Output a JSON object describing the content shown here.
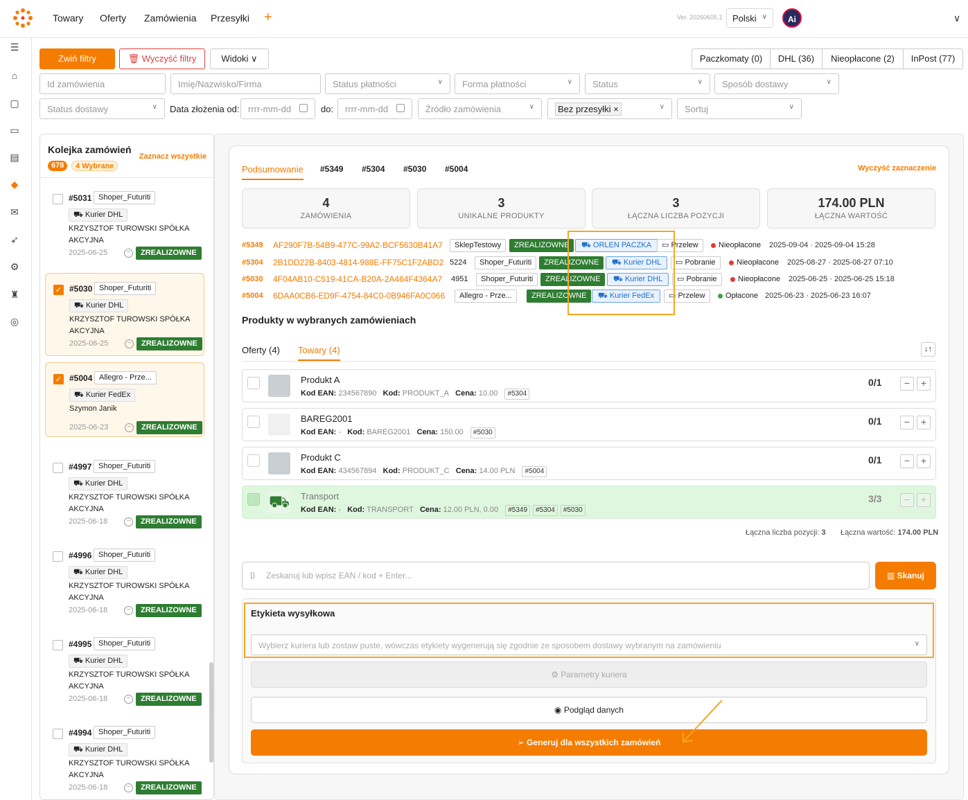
{
  "nav": {
    "items": [
      "Towary",
      "Oferty",
      "Zamówienia",
      "Przesyłki"
    ],
    "version": "Ver. 20260605.1",
    "language": "Polski",
    "avatar_text": "Ai"
  },
  "filters": {
    "collapse": "Zwiń filtry",
    "clear": "Wyczyść filtry",
    "views": "Widoki",
    "segments": [
      "Paczkomaty (0)",
      "DHL (36)",
      "Nieopłacone (2)",
      "InPost (77)"
    ],
    "row1": [
      "Id zamówienia",
      "Imię/Nazwisko/Firma",
      "Status płatności",
      "Forma płatności",
      "Status",
      "Sposób dostawy"
    ],
    "row2": {
      "delivery_status": "Status dostawy",
      "date_from_label": "Data złożenia od:",
      "date_from_ph": "rrrr-mm-dd",
      "date_to_label": "do:",
      "date_to_ph": "rrrr-mm-dd",
      "source": "Źródło zamówienia",
      "shipment": "Bez przesyłki",
      "sort": "Sortuj"
    }
  },
  "queue": {
    "title": "Kolejka zamówień",
    "select_all": "Zaznacz wszystkie",
    "count": "678",
    "selected": "4 Wybrane",
    "cards": [
      {
        "id": "#5031",
        "shop": "Shoper_Futuriti",
        "carrier": "Kurier DHL",
        "customer": "KRZYSZTOF TUROWSKI SPÓŁKA AKCYJNA",
        "date": "2025-06-25",
        "status": "ZREALIZOWNE",
        "checked": false
      },
      {
        "id": "#5030",
        "shop": "Shoper_Futuriti",
        "carrier": "Kurier DHL",
        "customer": "KRZYSZTOF TUROWSKI SPÓŁKA AKCYJNA",
        "date": "2025-06-25",
        "status": "ZREALIZOWNE",
        "checked": true
      },
      {
        "id": "#5004",
        "shop": "Allegro - Prze...",
        "carrier": "Kurier FedEx",
        "customer": "Szymon Janik",
        "date": "2025-06-23",
        "status": "ZREALIZOWNE",
        "checked": true
      },
      {
        "id": "#4997",
        "shop": "Shoper_Futuriti",
        "carrier": "Kurier DHL",
        "customer": "KRZYSZTOF TUROWSKI SPÓŁKA AKCYJNA",
        "date": "2025-06-18",
        "status": "ZREALIZOWNE",
        "checked": false
      },
      {
        "id": "#4996",
        "shop": "Shoper_Futuriti",
        "carrier": "Kurier DHL",
        "customer": "KRZYSZTOF TUROWSKI SPÓŁKA AKCYJNA",
        "date": "2025-06-18",
        "status": "ZREALIZOWNE",
        "checked": false
      },
      {
        "id": "#4995",
        "shop": "Shoper_Futuriti",
        "carrier": "Kurier DHL",
        "customer": "KRZYSZTOF TUROWSKI SPÓŁKA AKCYJNA",
        "date": "2025-06-18",
        "status": "ZREALIZOWNE",
        "checked": false
      },
      {
        "id": "#4994",
        "shop": "Shoper_Futuriti",
        "carrier": "Kurier DHL",
        "customer": "KRZYSZTOF TUROWSKI SPÓŁKA AKCYJNA",
        "date": "2025-06-18",
        "status": "ZREALIZOWNE",
        "checked": false
      }
    ]
  },
  "summary": {
    "tabs": [
      "Podsumowanie",
      "#5349",
      "#5304",
      "#5030",
      "#5004"
    ],
    "clear_selection": "Wyczyść zaznaczenie",
    "stats": [
      {
        "value": "4",
        "label": "ZAMÓWIENIA"
      },
      {
        "value": "3",
        "label": "UNIKALNE PRODUKTY"
      },
      {
        "value": "3",
        "label": "ŁĄCZNA LICZBA POZYCJI"
      },
      {
        "value": "174.00 PLN",
        "label": "ŁĄCZNA WARTOŚĆ"
      }
    ],
    "orders": [
      {
        "id": "#5349",
        "uuid": "AF290F7B-54B9-477C-99A2-BCF5630B41A7",
        "extra": "",
        "shop": "SklepTestowy",
        "status": "ZREALIZOWNE",
        "ship": "ORLEN PACZKA",
        "pay": "Przelew",
        "paystatus": "Nieopłacone",
        "dates": "2025-09-04 · 2025-09-04 15:28",
        "paid": false
      },
      {
        "id": "#5304",
        "uuid": "2B1DD22B-8403-4814-988E-FF75C1F2ABD2",
        "extra": "5224",
        "shop": "Shoper_Futuriti",
        "status": "ZREALIZOWNE",
        "ship": "Kurier DHL",
        "pay": "Pobranie",
        "paystatus": "Nieopłacone",
        "dates": "2025-08-27 · 2025-08-27 07:10",
        "paid": false
      },
      {
        "id": "#5030",
        "uuid": "4F04AB10-C519-41CA-B20A-2A464F4364A7",
        "extra": "4951",
        "shop": "Shoper_Futuriti",
        "status": "ZREALIZOWNE",
        "ship": "Kurier DHL",
        "pay": "Pobranie",
        "paystatus": "Nieopłacone",
        "dates": "2025-06-25 · 2025-06-25 15:18",
        "paid": false
      },
      {
        "id": "#5004",
        "uuid": "6DAA0CB6-ED9F-4754-84C0-0B946FA0C066",
        "extra": "",
        "shop": "Allegro - Prze...",
        "status": "ZREALIZOWNE",
        "ship": "Kurier FedEx",
        "pay": "Przelew",
        "paystatus": "Opłacone",
        "dates": "2025-06-23 · 2025-06-23 16:07",
        "paid": true
      }
    ]
  },
  "products": {
    "title": "Produkty w wybranych zamówieniach",
    "tabs": [
      "Oferty (4)",
      "Towary (4)"
    ],
    "items": [
      {
        "name": "Produkt A",
        "ean_label": "Kod EAN:",
        "ean": "234567890",
        "kod_label": "Kod:",
        "kod": "PRODUKT_A",
        "price_label": "Cena:",
        "price": "10.00",
        "refs": [
          "#5304"
        ],
        "qty": "0/1"
      },
      {
        "name": "BAREG2001",
        "ean_label": "Kod EAN:",
        "ean": "-",
        "kod_label": "Kod:",
        "kod": "BAREG2001",
        "price_label": "Cena:",
        "price": "150.00",
        "refs": [
          "#5030"
        ],
        "qty": "0/1"
      },
      {
        "name": "Produkt C",
        "ean_label": "Kod EAN:",
        "ean": "434567894",
        "kod_label": "Kod:",
        "kod": "PRODUKT_C",
        "price_label": "Cena:",
        "price": "14.00 PLN",
        "refs": [
          "#5004"
        ],
        "qty": "0/1"
      },
      {
        "name": "Transport",
        "ean_label": "Kod EAN:",
        "ean": "-",
        "kod_label": "Kod:",
        "kod": "TRANSPORT",
        "price_label": "Cena:",
        "price": "12.00 PLN, 0.00",
        "refs": [
          "#5349",
          "#5304",
          "#5030"
        ],
        "qty": "3/3"
      }
    ],
    "totals_label": "Łączna liczba pozycji:",
    "totals_count": "3",
    "value_label": "Łączna wartość:",
    "value": "174.00 PLN"
  },
  "scan": {
    "placeholder": "Zeskanuj lub wpisz EAN / kod + Enter...",
    "button": "Skanuj"
  },
  "label": {
    "title": "Etykieta wysyłkowa",
    "courier_placeholder": "Wybierz kuriera lub zostaw puste, wówczas etykiety wygenerują się zgodnie ze sposobem dostawy wybranym na zamówieniu",
    "params": "Parametry kuriera",
    "preview": "Podgląd danych",
    "generate": "Generuj dla wszystkich zamówień"
  },
  "colors": {
    "accent": "#f47c00",
    "done": "#2e7d32",
    "ship_blue": "#1f6fc8",
    "highlight": "#f5a623"
  }
}
